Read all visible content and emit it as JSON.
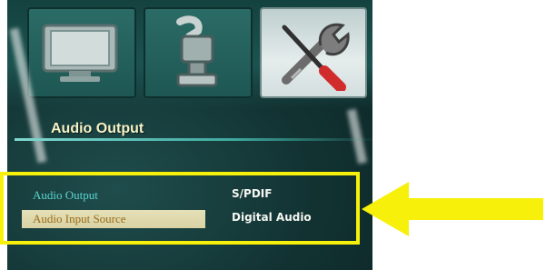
{
  "menu": {
    "tabs": [
      {
        "label": "",
        "icon": "monitor-icon",
        "selected": false
      },
      {
        "label": "",
        "icon": "audio-plug-icon",
        "selected": false
      },
      {
        "label": "",
        "icon": "wrench-screwdriver-icon",
        "selected": true
      }
    ],
    "section_title": "Audio Output",
    "items": [
      {
        "label": "Audio Output",
        "value": "S/PDIF",
        "selected": false
      },
      {
        "label": "Audio Input Source",
        "value": "Digital Audio",
        "selected": true
      }
    ]
  },
  "colors": {
    "highlight": "#f7f00a",
    "selected_row": "#ddd7aa",
    "label_text": "#5ad4d0",
    "background": "#163b3a"
  }
}
